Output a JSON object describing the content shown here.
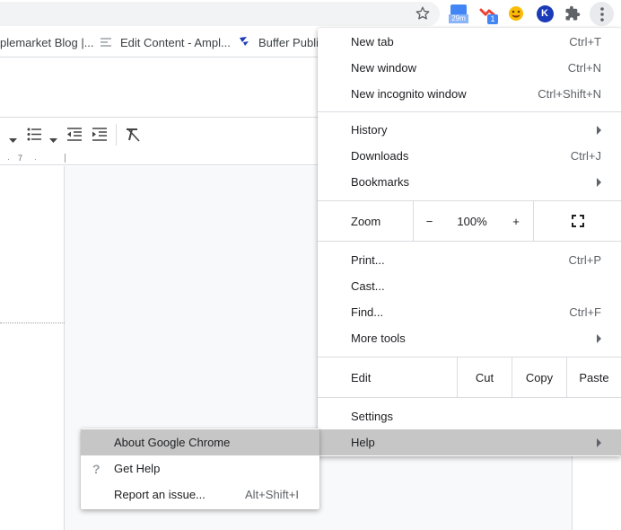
{
  "toolbar": {
    "icons": [
      "star-icon",
      "calendar-extension-icon",
      "pocket-extension-icon",
      "emoji-extension-icon",
      "k-extension-icon",
      "puzzle-icon",
      "kebab-menu-icon"
    ],
    "calendar_badge": "29m",
    "pocket_badge": "1",
    "k_letter": "K"
  },
  "bookmarks": [
    {
      "label": "plemarket Blog |..."
    },
    {
      "label": "Edit Content - Ampl..."
    },
    {
      "label": "Buffer Publis"
    }
  ],
  "docs": {
    "ruler_number": "7"
  },
  "chrome_menu": {
    "items_group1": [
      {
        "label": "New tab",
        "shortcut": "Ctrl+T"
      },
      {
        "label": "New window",
        "shortcut": "Ctrl+N"
      },
      {
        "label": "New incognito window",
        "shortcut": "Ctrl+Shift+N"
      }
    ],
    "items_group2": [
      {
        "label": "History",
        "submenu": true
      },
      {
        "label": "Downloads",
        "shortcut": "Ctrl+J"
      },
      {
        "label": "Bookmarks",
        "submenu": true
      }
    ],
    "zoom": {
      "label": "Zoom",
      "minus": "−",
      "value": "100%",
      "plus": "+"
    },
    "items_group3": [
      {
        "label": "Print...",
        "shortcut": "Ctrl+P"
      },
      {
        "label": "Cast..."
      },
      {
        "label": "Find...",
        "shortcut": "Ctrl+F"
      },
      {
        "label": "More tools",
        "submenu": true
      }
    ],
    "edit": {
      "label": "Edit",
      "cut": "Cut",
      "copy": "Copy",
      "paste": "Paste"
    },
    "items_group4": [
      {
        "label": "Settings"
      },
      {
        "label": "Help",
        "submenu": true,
        "highlighted": true
      }
    ]
  },
  "help_submenu": {
    "items": [
      {
        "label": "About Google Chrome",
        "highlighted": true
      },
      {
        "label": "Get Help",
        "icon": "?"
      },
      {
        "label": "Report an issue...",
        "shortcut": "Alt+Shift+I"
      }
    ]
  },
  "colors": {
    "highlight": "#c6c6c6",
    "calendar_blue": "#4285f4",
    "k_extension_blue": "#1a3ab8"
  }
}
